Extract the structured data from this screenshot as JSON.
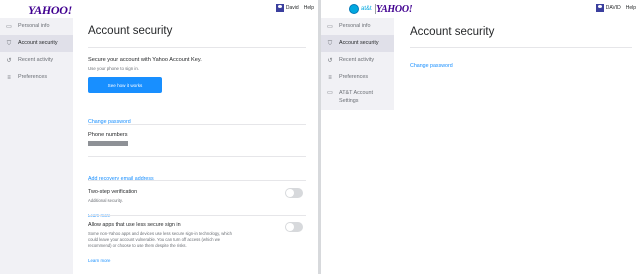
{
  "left": {
    "logo": "YAHOO!",
    "user": {
      "name": "David",
      "help": "Help"
    },
    "sidebar": [
      {
        "icon": "▭",
        "icon_name": "id-card-icon",
        "label": "Personal info",
        "active": false
      },
      {
        "icon": "⛉",
        "icon_name": "shield-icon",
        "label": "Account security",
        "active": true
      },
      {
        "icon": "↺",
        "icon_name": "history-icon",
        "label": "Recent activity",
        "active": false
      },
      {
        "icon": "≡",
        "icon_name": "list-icon",
        "label": "Preferences",
        "active": false
      }
    ],
    "main": {
      "title": "Account security",
      "key": {
        "heading": "Secure your account with Yahoo Account Key.",
        "sub": "Use your phone to sign in.",
        "button": "See how it works"
      },
      "change_password": "Change password",
      "phone_label": "Phone numbers",
      "add_recovery": "Add recovery email address",
      "two_step": {
        "title": "Two-step verification",
        "desc": "Additional security.",
        "learn": "Learn more",
        "enabled": false
      },
      "less_secure": {
        "title": "Allow apps that use less secure sign in",
        "desc": "Some non-Yahoo apps and devices use less secure sign-in technology, which could leave your account vulnerable. You can turn off access (which we recommend) or choose to use them despite the risks.",
        "learn": "Learn more",
        "enabled": false
      }
    }
  },
  "right": {
    "att_label": "at&t",
    "logo": "YAHOO!",
    "user": {
      "name": "DAVID",
      "help": "Help"
    },
    "sidebar": [
      {
        "icon": "▭",
        "icon_name": "id-card-icon",
        "label": "Personal info",
        "active": false
      },
      {
        "icon": "⛉",
        "icon_name": "shield-icon",
        "label": "Account security",
        "active": true
      },
      {
        "icon": "↺",
        "icon_name": "history-icon",
        "label": "Recent activity",
        "active": false
      },
      {
        "icon": "≡",
        "icon_name": "list-icon",
        "label": "Preferences",
        "active": false
      },
      {
        "icon": "▭",
        "icon_name": "settings-icon",
        "label": "AT&T Account Settings",
        "active": false
      }
    ],
    "main": {
      "title": "Account security",
      "change_password": "Change password"
    }
  },
  "colors": {
    "brand_purple": "#400090",
    "link_blue": "#188fff",
    "sidebar_bg": "#f1f1f5",
    "sidebar_active": "#e0e0e9",
    "toggle_off": "#d7d9dc",
    "att_blue": "#00a8e0"
  }
}
